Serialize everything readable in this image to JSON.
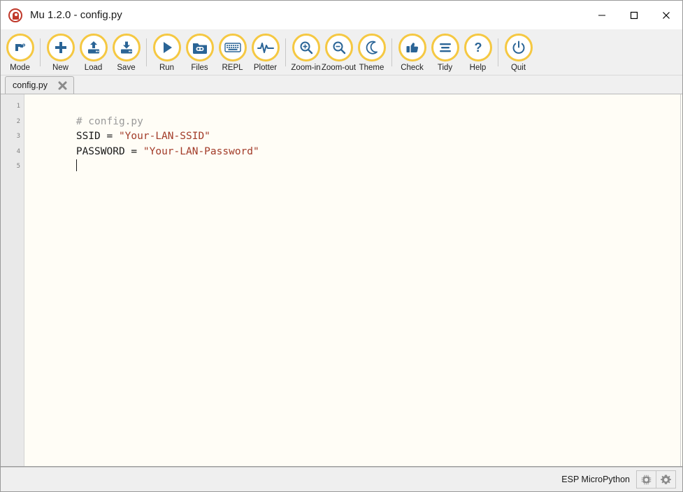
{
  "window": {
    "title": "Mu 1.2.0 - config.py",
    "logo_icon": "mu-logo-icon",
    "controls": [
      {
        "name": "minimize-button",
        "icon": "minimize-icon"
      },
      {
        "name": "maximize-button",
        "icon": "maximize-icon"
      },
      {
        "name": "close-button",
        "icon": "close-icon"
      }
    ]
  },
  "toolbar": {
    "groups": [
      {
        "items": [
          {
            "label": "Mode",
            "icon": "mode-robot-icon",
            "name": "toolbar-button-mode"
          }
        ]
      },
      {
        "items": [
          {
            "label": "New",
            "icon": "plus-icon",
            "name": "toolbar-button-new"
          },
          {
            "label": "Load",
            "icon": "upload-icon",
            "name": "toolbar-button-load"
          },
          {
            "label": "Save",
            "icon": "download-icon",
            "name": "toolbar-button-save"
          }
        ]
      },
      {
        "items": [
          {
            "label": "Run",
            "icon": "play-icon",
            "name": "toolbar-button-run"
          },
          {
            "label": "Files",
            "icon": "folder-robot-icon",
            "name": "toolbar-button-files"
          },
          {
            "label": "REPL",
            "icon": "keyboard-icon",
            "name": "toolbar-button-repl"
          },
          {
            "label": "Plotter",
            "icon": "waveform-icon",
            "name": "toolbar-button-plotter"
          }
        ]
      },
      {
        "items": [
          {
            "label": "Zoom-in",
            "icon": "magnifier-plus-icon",
            "name": "toolbar-button-zoom-in"
          },
          {
            "label": "Zoom-out",
            "icon": "magnifier-minus-icon",
            "name": "toolbar-button-zoom-out"
          },
          {
            "label": "Theme",
            "icon": "moon-icon",
            "name": "toolbar-button-theme"
          }
        ]
      },
      {
        "items": [
          {
            "label": "Check",
            "icon": "thumbs-up-icon",
            "name": "toolbar-button-check"
          },
          {
            "label": "Tidy",
            "icon": "lines-icon",
            "name": "toolbar-button-tidy"
          },
          {
            "label": "Help",
            "icon": "question-mark-icon",
            "name": "toolbar-button-help"
          }
        ]
      },
      {
        "items": [
          {
            "label": "Quit",
            "icon": "power-icon",
            "name": "toolbar-button-quit"
          }
        ]
      }
    ]
  },
  "tabs": [
    {
      "label": "config.py",
      "close_icon": "close-icon",
      "active": true
    }
  ],
  "editor": {
    "line_numbers": [
      "1",
      "2",
      "3",
      "4",
      "5"
    ],
    "lines": [
      {
        "tokens": [
          {
            "type": "comment",
            "text": "# config.py"
          }
        ]
      },
      {
        "tokens": [
          {
            "type": "plain",
            "text": "SSID = "
          },
          {
            "type": "string",
            "text": "\"Your-LAN-SSID\""
          }
        ]
      },
      {
        "tokens": [
          {
            "type": "plain",
            "text": "PASSWORD = "
          },
          {
            "type": "string",
            "text": "\"Your-LAN-Password\""
          }
        ]
      },
      {
        "tokens": [],
        "caret": true
      },
      {
        "tokens": []
      }
    ]
  },
  "statusbar": {
    "mode_text": "ESP MicroPython",
    "buttons": [
      {
        "name": "device-chip-button",
        "icon": "microchip-icon"
      },
      {
        "name": "settings-button",
        "icon": "gear-icon"
      }
    ]
  },
  "colors": {
    "icon_ring": "#f5c842",
    "icon_glyph": "#2a6496",
    "editor_background": "#fffdf6",
    "string_token": "#a23b28",
    "comment_token": "#9a9a9a",
    "logo_red": "#c0392b"
  }
}
